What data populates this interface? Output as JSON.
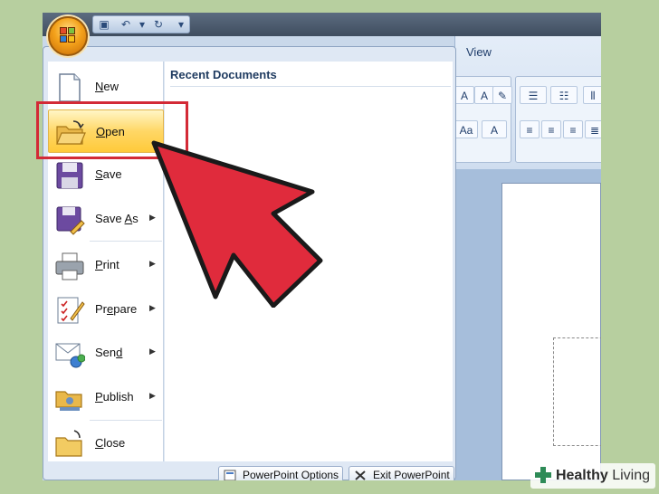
{
  "ribbon": {
    "view_tab": "View",
    "font_buttons": [
      "A",
      "A",
      "Aa",
      "A"
    ]
  },
  "office_menu": {
    "recent_heading": "Recent Documents",
    "commands": [
      {
        "label": "New",
        "accel": "N",
        "rest": "ew",
        "has_submenu": false,
        "icon": "new-document-icon"
      },
      {
        "label": "Open",
        "accel": "O",
        "rest": "pen",
        "has_submenu": false,
        "icon": "open-folder-icon",
        "highlighted": true
      },
      {
        "label": "Save",
        "accel": "S",
        "rest": "ave",
        "has_submenu": false,
        "icon": "save-disk-icon"
      },
      {
        "label": "Save As",
        "pre": "Save ",
        "accel": "A",
        "rest": "s",
        "has_submenu": true,
        "icon": "save-as-icon"
      },
      {
        "label": "Print",
        "accel": "P",
        "rest": "rint",
        "has_submenu": true,
        "icon": "printer-icon"
      },
      {
        "label": "Prepare",
        "pre": "Pr",
        "accel": "e",
        "rest": "pare",
        "has_submenu": true,
        "icon": "prepare-icon"
      },
      {
        "label": "Send",
        "pre": "Sen",
        "accel": "d",
        "rest": "",
        "has_submenu": true,
        "icon": "send-icon"
      },
      {
        "label": "Publish",
        "accel": "P",
        "rest": "ublish",
        "has_submenu": true,
        "icon": "publish-icon"
      },
      {
        "label": "Close",
        "accel": "C",
        "rest": "lose",
        "has_submenu": false,
        "icon": "close-folder-icon"
      }
    ],
    "footer": {
      "options_label": "PowerPoint Options",
      "exit_label": "Exit PowerPoint"
    }
  },
  "watermark": {
    "bold": "Healthy",
    "rest": " Living"
  },
  "colors": {
    "highlight_frame": "#d32a36",
    "pointer_arrow": "#d32a36",
    "menu_highlight": "#ffd766"
  }
}
